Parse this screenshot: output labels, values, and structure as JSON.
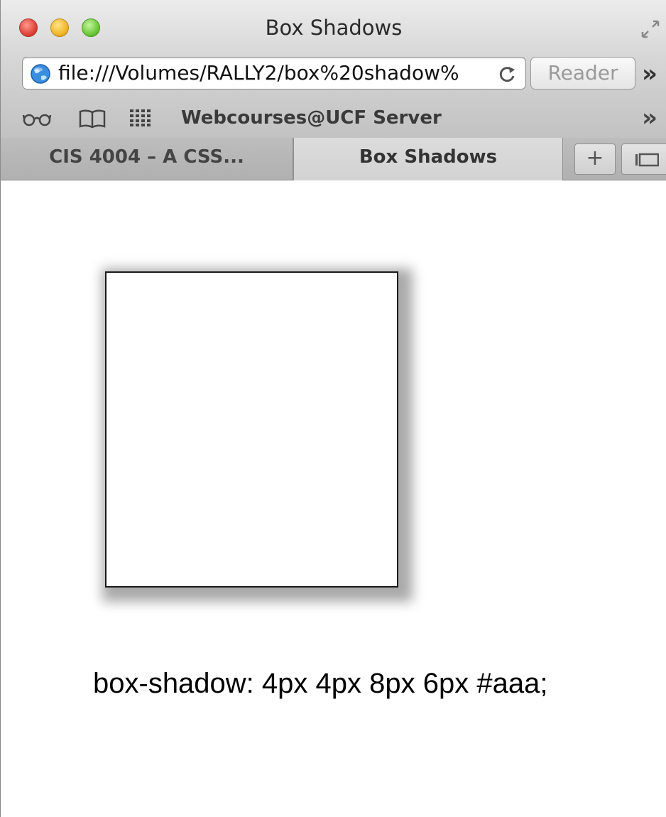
{
  "window": {
    "title": "Box Shadows",
    "close_icon": "close-icon",
    "minimize_icon": "minimize-icon",
    "zoom_icon": "zoom-icon",
    "fullscreen_icon": "fullscreen-icon"
  },
  "toolbar": {
    "url": "file:///Volumes/RALLY2/box%20shadow%",
    "site_icon": "globe-icon",
    "reload_icon": "reload-icon",
    "reader_label": "Reader",
    "overflow_label": "»"
  },
  "bookmarks_bar": {
    "reading_list_icon": "reading-list-icon",
    "bookmarks_icon": "bookmarks-icon",
    "top_sites_icon": "top-sites-icon",
    "items": [
      {
        "label": "Webcourses@UCF Server"
      }
    ],
    "overflow_label": "»"
  },
  "tabs": [
    {
      "label": "CIS 4004 – A CSS...",
      "active": false
    },
    {
      "label": "Box Shadows",
      "active": true
    }
  ],
  "tab_bar": {
    "new_tab_label": "+",
    "tab_overview_icon": "tab-overview-icon"
  },
  "content": {
    "caption": "box-shadow: 4px 4px 8px 6px #aaa;",
    "shadow_color": "#aaa"
  }
}
